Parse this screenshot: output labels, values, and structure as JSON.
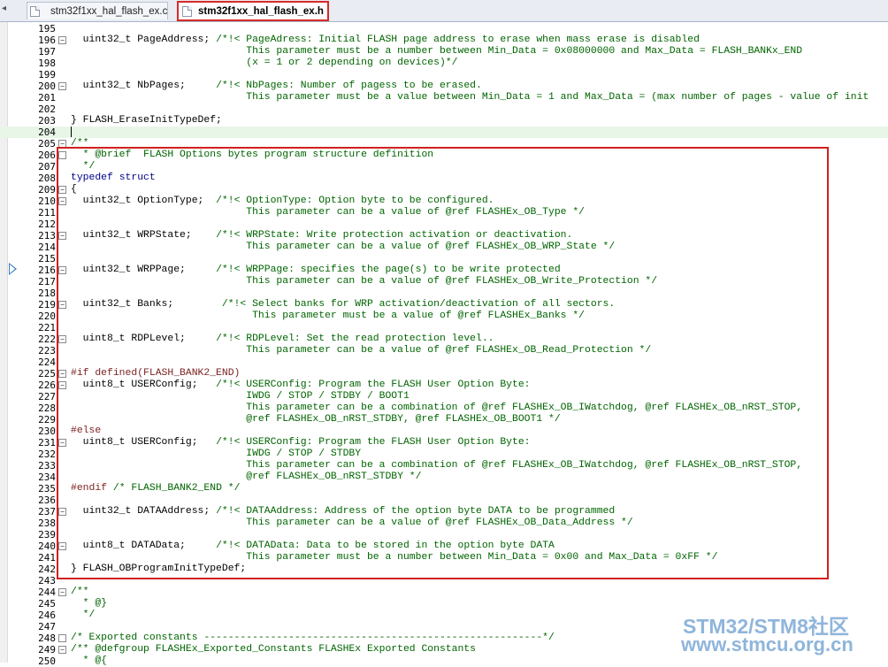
{
  "tabs": [
    {
      "label": "stm32f1xx_hal_flash_ex.c",
      "active": false
    },
    {
      "label": "stm32f1xx_hal_flash_ex.h",
      "active": true
    }
  ],
  "colors": {
    "comment": "#006400",
    "keyword": "#00008b",
    "preprocessor": "#7a1f1f",
    "highlight": "#d21f1f",
    "current_line": "#e8f6e8"
  },
  "lines": [
    {
      "n": "195",
      "t": ""
    },
    {
      "n": "196",
      "t": "  uint32_t PageAddress; /*!< PageAdress: Initial FLASH page address to erase when mass erase is disabled"
    },
    {
      "n": "197",
      "t": "                             This parameter must be a number between Min_Data = 0x08000000 and Max_Data = FLASH_BANKx_END"
    },
    {
      "n": "198",
      "t": "                             (x = 1 or 2 depending on devices)*/"
    },
    {
      "n": "199",
      "t": ""
    },
    {
      "n": "200",
      "t": "  uint32_t NbPages;     /*!< NbPages: Number of pagess to be erased."
    },
    {
      "n": "201",
      "t": "                             This parameter must be a value between Min_Data = 1 and Max_Data = (max number of pages - value of init"
    },
    {
      "n": "202",
      "t": ""
    },
    {
      "n": "203",
      "t": "} FLASH_EraseInitTypeDef;"
    },
    {
      "n": "204",
      "t": ""
    },
    {
      "n": "205",
      "t": "/**"
    },
    {
      "n": "206",
      "t": "  * @brief  FLASH Options bytes program structure definition"
    },
    {
      "n": "207",
      "t": "  */"
    },
    {
      "n": "208",
      "t": "typedef struct"
    },
    {
      "n": "209",
      "t": "{"
    },
    {
      "n": "210",
      "t": "  uint32_t OptionType;  /*!< OptionType: Option byte to be configured."
    },
    {
      "n": "211",
      "t": "                             This parameter can be a value of @ref FLASHEx_OB_Type */"
    },
    {
      "n": "212",
      "t": ""
    },
    {
      "n": "213",
      "t": "  uint32_t WRPState;    /*!< WRPState: Write protection activation or deactivation."
    },
    {
      "n": "214",
      "t": "                             This parameter can be a value of @ref FLASHEx_OB_WRP_State */"
    },
    {
      "n": "215",
      "t": ""
    },
    {
      "n": "216",
      "t": "  uint32_t WRPPage;     /*!< WRPPage: specifies the page(s) to be write protected"
    },
    {
      "n": "217",
      "t": "                             This parameter can be a value of @ref FLASHEx_OB_Write_Protection */"
    },
    {
      "n": "218",
      "t": ""
    },
    {
      "n": "219",
      "t": "  uint32_t Banks;        /*!< Select banks for WRP activation/deactivation of all sectors."
    },
    {
      "n": "220",
      "t": "                              This parameter must be a value of @ref FLASHEx_Banks */"
    },
    {
      "n": "221",
      "t": ""
    },
    {
      "n": "222",
      "t": "  uint8_t RDPLevel;     /*!< RDPLevel: Set the read protection level.."
    },
    {
      "n": "223",
      "t": "                             This parameter can be a value of @ref FLASHEx_OB_Read_Protection */"
    },
    {
      "n": "224",
      "t": ""
    },
    {
      "n": "225",
      "t": "#if defined(FLASH_BANK2_END)"
    },
    {
      "n": "226",
      "t": "  uint8_t USERConfig;   /*!< USERConfig: Program the FLASH User Option Byte:"
    },
    {
      "n": "227",
      "t": "                             IWDG / STOP / STDBY / BOOT1"
    },
    {
      "n": "228",
      "t": "                             This parameter can be a combination of @ref FLASHEx_OB_IWatchdog, @ref FLASHEx_OB_nRST_STOP,"
    },
    {
      "n": "229",
      "t": "                             @ref FLASHEx_OB_nRST_STDBY, @ref FLASHEx_OB_BOOT1 */"
    },
    {
      "n": "230",
      "t": "#else"
    },
    {
      "n": "231",
      "t": "  uint8_t USERConfig;   /*!< USERConfig: Program the FLASH User Option Byte:"
    },
    {
      "n": "232",
      "t": "                             IWDG / STOP / STDBY"
    },
    {
      "n": "233",
      "t": "                             This parameter can be a combination of @ref FLASHEx_OB_IWatchdog, @ref FLASHEx_OB_nRST_STOP,"
    },
    {
      "n": "234",
      "t": "                             @ref FLASHEx_OB_nRST_STDBY */"
    },
    {
      "n": "235",
      "t": "#endif /* FLASH_BANK2_END */"
    },
    {
      "n": "236",
      "t": ""
    },
    {
      "n": "237",
      "t": "  uint32_t DATAAddress; /*!< DATAAddress: Address of the option byte DATA to be programmed"
    },
    {
      "n": "238",
      "t": "                             This parameter can be a value of @ref FLASHEx_OB_Data_Address */"
    },
    {
      "n": "239",
      "t": ""
    },
    {
      "n": "240",
      "t": "  uint8_t DATAData;     /*!< DATAData: Data to be stored in the option byte DATA"
    },
    {
      "n": "241",
      "t": "                             This parameter must be a number between Min_Data = 0x00 and Max_Data = 0xFF */"
    },
    {
      "n": "242",
      "t": "} FLASH_OBProgramInitTypeDef;"
    },
    {
      "n": "243",
      "t": ""
    },
    {
      "n": "244",
      "t": "/**"
    },
    {
      "n": "245",
      "t": "  * @}"
    },
    {
      "n": "246",
      "t": "  */"
    },
    {
      "n": "247",
      "t": ""
    },
    {
      "n": "248",
      "t": "/* Exported constants --------------------------------------------------------*/"
    },
    {
      "n": "249",
      "t": "/** @defgroup FLASHEx_Exported_Constants FLASHEx Exported Constants"
    },
    {
      "n": "250",
      "t": "  * @{"
    }
  ],
  "watermark": {
    "line1": "STM32/STM8社区",
    "line2": "www.stmcu.org.cn"
  }
}
